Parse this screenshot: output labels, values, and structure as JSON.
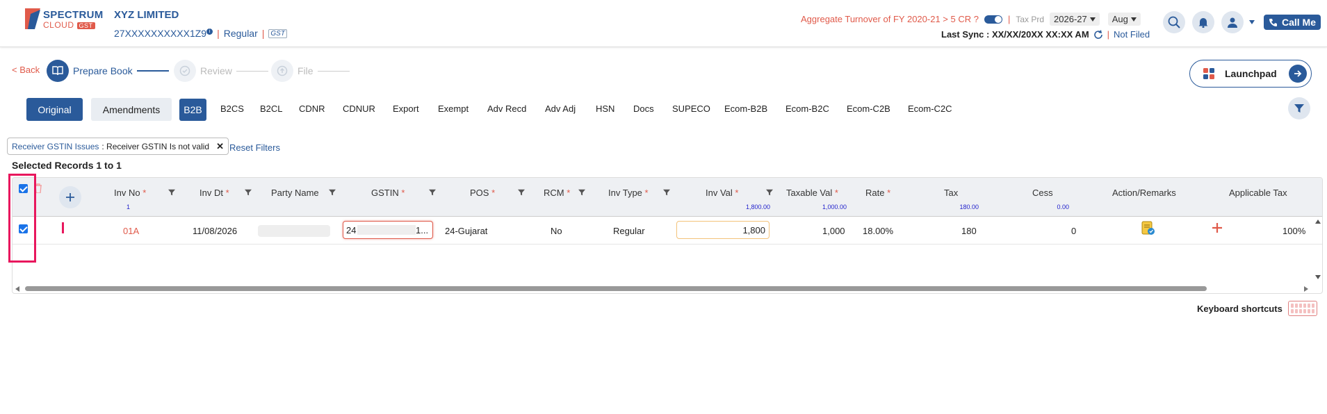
{
  "header": {
    "brand_line1": "SPECTRUM",
    "brand_line2": "CLOUD",
    "brand_badge": "GST",
    "company": "XYZ LIMITED",
    "gstin": "27XXXXXXXXXX1Z9",
    "reg_type": "Regular",
    "gst_logo": "GST",
    "aggregate": "Aggregate Turnover of FY 2020-21 > 5 CR ?",
    "tax_prd_label": "Tax Prd",
    "year": "2026-27",
    "month": "Aug",
    "last_sync": "Last Sync : XX/XX/20XX XX:XX AM",
    "filed_status": "Not Filed",
    "call_label": "Call Me"
  },
  "steps": {
    "back": "< Back",
    "prepare": "Prepare Book",
    "review": "Review",
    "file": "File"
  },
  "launchpad": "Launchpad",
  "tabs": {
    "original": "Original",
    "amendments": "Amendments",
    "items": [
      "B2B",
      "B2CS",
      "B2CL",
      "CDNR",
      "CDNUR",
      "Export",
      "Exempt",
      "Adv Recd",
      "Adv Adj",
      "HSN",
      "Docs",
      "SUPECO",
      "Ecom-B2B",
      "Ecom-B2C",
      "Ecom-C2B",
      "Ecom-C2C"
    ]
  },
  "filter": {
    "key": "Receiver GSTIN Issues",
    "value": " : Receiver GSTIN Is not valid",
    "reset": "Reset Filters",
    "selected": "Selected Records 1 to 1"
  },
  "table": {
    "headers": {
      "inv_no": "Inv No",
      "inv_dt": "Inv Dt",
      "party": "Party Name",
      "gstin": "GSTIN",
      "pos": "POS",
      "rcm": "RCM",
      "inv_type": "Inv Type",
      "inv_val": "Inv Val",
      "taxable": "Taxable Val",
      "rate": "Rate",
      "tax": "Tax",
      "cess": "Cess",
      "action": "Action/Remarks",
      "applicable": "Applicable Tax"
    },
    "totals": {
      "inv_no": "1",
      "inv_val": "1,800.00",
      "taxable": "1,000.00",
      "tax": "180.00",
      "cess": "0.00"
    },
    "row": {
      "inv_no": "01A",
      "inv_dt": "11/08/2026",
      "gstin_start": "24",
      "gstin_end": "1...",
      "pos": "24-Gujarat",
      "rcm": "No",
      "inv_type": "Regular",
      "inv_val": "1,800",
      "taxable": "1,000",
      "rate": "18.00%",
      "tax": "180",
      "cess": "0",
      "applicable": "100%"
    }
  },
  "keyboard_shortcuts": "Keyboard shortcuts",
  "colors": {
    "primary": "#2a5a9a",
    "accent": "#e05a4a",
    "highlight": "#e8175d"
  }
}
